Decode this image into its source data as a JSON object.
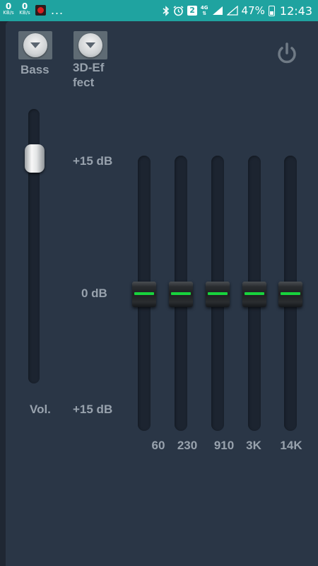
{
  "status_bar": {
    "net_speeds": [
      {
        "value": "0",
        "unit": "KB/s"
      },
      {
        "value": "0",
        "unit": "KB/s"
      }
    ],
    "overflow": "...",
    "notification_count": "2",
    "network_type": "4G",
    "battery_percent": "47%",
    "time": "12:43"
  },
  "controls": {
    "bass_label": "Bass",
    "effect_label_line1": "3D-Ef",
    "effect_label_line2": "fect"
  },
  "volume": {
    "label": "Vol.",
    "level": 0.87
  },
  "scale": {
    "top": "+15 dB",
    "middle": "0 dB",
    "bottom": "+15 dB"
  },
  "bands": [
    {
      "label": "60",
      "gain_db": 0
    },
    {
      "label": "230",
      "gain_db": 0
    },
    {
      "label": "910",
      "gain_db": 0
    },
    {
      "label": "3K",
      "gain_db": 0
    },
    {
      "label": "14K",
      "gain_db": 0
    }
  ]
}
